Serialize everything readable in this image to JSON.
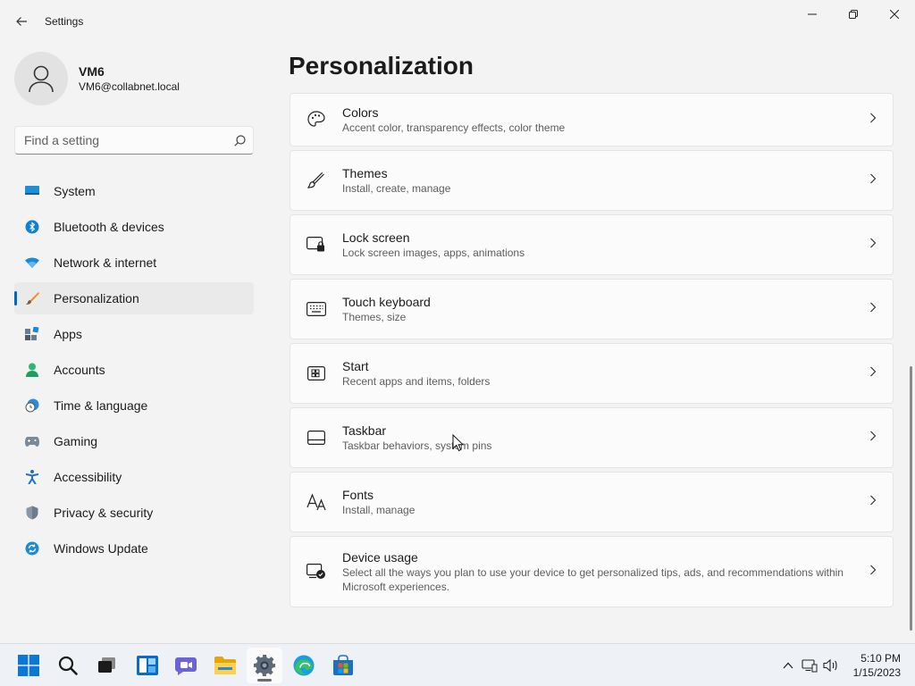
{
  "window": {
    "title": "Settings",
    "controls": [
      "minimize-icon",
      "restore-icon",
      "close-icon"
    ]
  },
  "profile": {
    "name": "VM6",
    "email": "VM6@collabnet.local"
  },
  "search": {
    "placeholder": "Find a setting"
  },
  "sidebar": {
    "items": [
      {
        "label": "System",
        "icon": "system-icon"
      },
      {
        "label": "Bluetooth & devices",
        "icon": "bluetooth-icon"
      },
      {
        "label": "Network & internet",
        "icon": "wifi-icon"
      },
      {
        "label": "Personalization",
        "icon": "brush-icon",
        "active": true
      },
      {
        "label": "Apps",
        "icon": "apps-icon"
      },
      {
        "label": "Accounts",
        "icon": "accounts-icon"
      },
      {
        "label": "Time & language",
        "icon": "clock-globe-icon"
      },
      {
        "label": "Gaming",
        "icon": "gamepad-icon"
      },
      {
        "label": "Accessibility",
        "icon": "accessibility-icon"
      },
      {
        "label": "Privacy & security",
        "icon": "shield-icon"
      },
      {
        "label": "Windows Update",
        "icon": "update-icon"
      }
    ]
  },
  "main": {
    "title": "Personalization",
    "cards": [
      {
        "title": "Colors",
        "desc": "Accent color, transparency effects, color theme",
        "icon": "palette-icon"
      },
      {
        "title": "Themes",
        "desc": "Install, create, manage",
        "icon": "brush-icon"
      },
      {
        "title": "Lock screen",
        "desc": "Lock screen images, apps, animations",
        "icon": "lock-screen-icon"
      },
      {
        "title": "Touch keyboard",
        "desc": "Themes, size",
        "icon": "keyboard-icon"
      },
      {
        "title": "Start",
        "desc": "Recent apps and items, folders",
        "icon": "start-icon"
      },
      {
        "title": "Taskbar",
        "desc": "Taskbar behaviors, system pins",
        "icon": "taskbar-icon"
      },
      {
        "title": "Fonts",
        "desc": "Install, manage",
        "icon": "fonts-icon"
      },
      {
        "title": "Device usage",
        "desc": "Select all the ways you plan to use your device to get personalized tips, ads, and recommendations within Microsoft experiences.",
        "icon": "device-usage-icon"
      }
    ]
  },
  "taskbar": {
    "apps": [
      "windows-start-icon",
      "search-icon",
      "task-view-icon",
      "widgets-icon",
      "teams-chat-icon",
      "file-explorer-icon",
      "settings-icon",
      "edge-icon",
      "store-icon"
    ],
    "active_app": "settings-icon",
    "clock": {
      "time": "5:10 PM",
      "date": "1/15/2023"
    }
  },
  "colors": {
    "accent": "#0067c0",
    "background": "#f3f3f3",
    "card": "#fbfbfb"
  }
}
